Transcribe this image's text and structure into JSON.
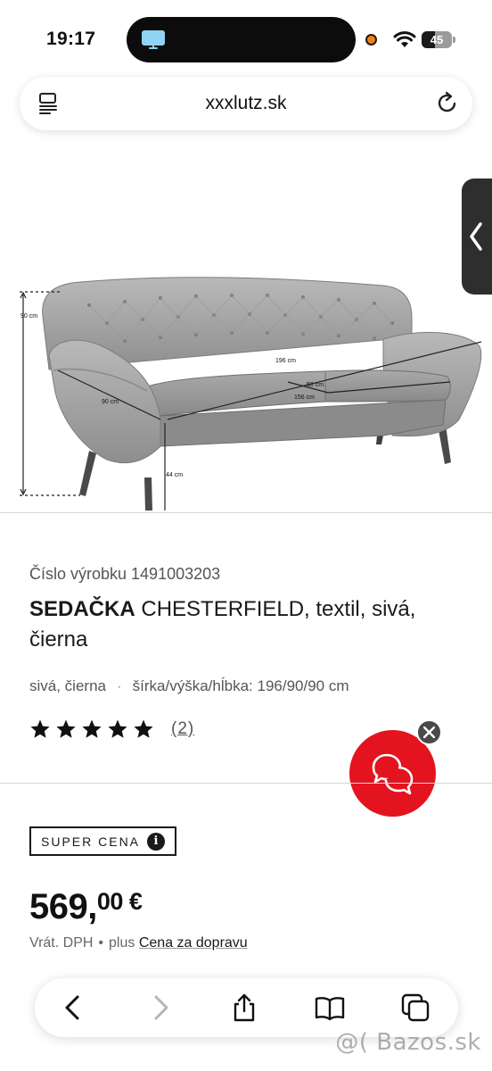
{
  "status_bar": {
    "time": "19:17",
    "battery_percent": 45,
    "battery_label": "45"
  },
  "browser": {
    "url": "xxxlutz.sk"
  },
  "product_image": {
    "dimensions": {
      "height": "90 cm",
      "width": "196 cm",
      "depth": "90 cm",
      "seat_depth": "58 cm",
      "seat_width": "156 cm",
      "seat_height": "44 cm"
    }
  },
  "product": {
    "number_line": "Číslo výrobku 1491003203",
    "title_bold": "SEDAČKA",
    "title_rest": " CHESTERFIELD, textil, sivá, čierna",
    "color": "sivá, čierna",
    "separator": "·",
    "dimensions_text": "šírka/výška/hĺbka: 196/90/90 cm",
    "rating_stars": 5,
    "rating_count": "(2)"
  },
  "price": {
    "badge": "SUPER CENA",
    "badge_info": "i",
    "amount_main": "569,",
    "amount_cents": "00 €",
    "vat": "Vrát. DPH",
    "dot": "•",
    "plus": "plus",
    "shipping_link": "Cena za dopravu"
  },
  "colors": {
    "accent_red": "#e3141f",
    "text_dark": "#1a1a1a",
    "text_muted": "#555555"
  },
  "watermark": "@( Bazos.sk"
}
